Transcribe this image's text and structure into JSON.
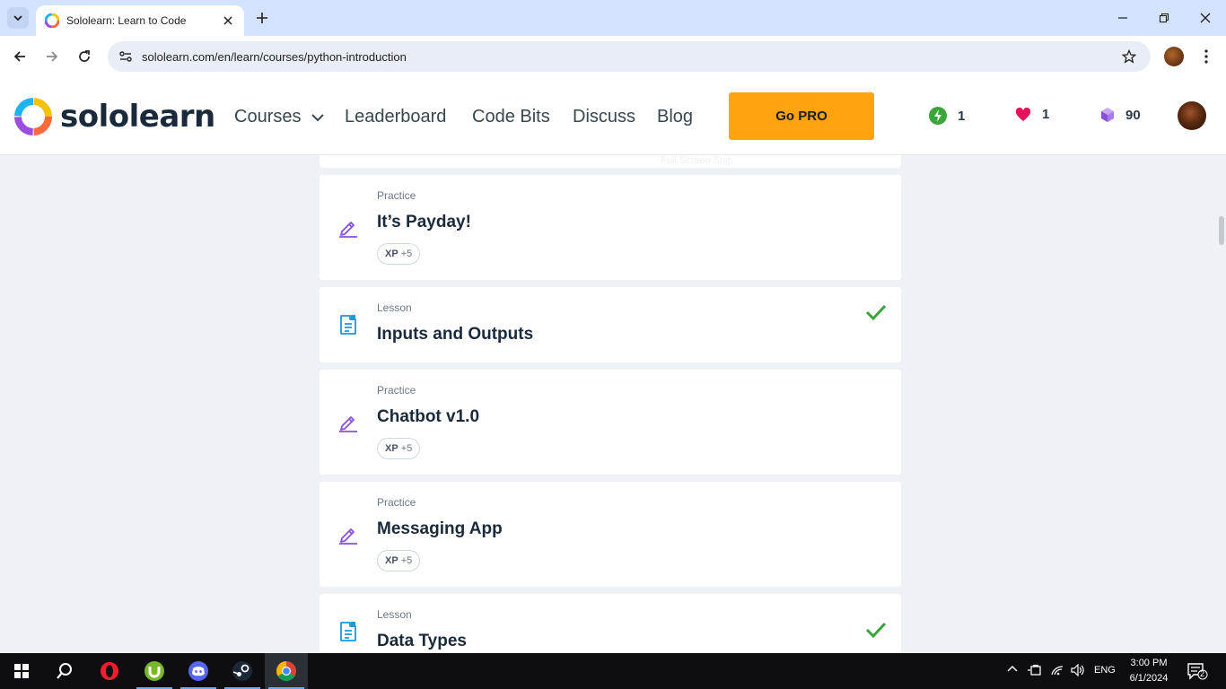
{
  "browser": {
    "tab_title": "Sololearn: Learn to Code",
    "url": "sololearn.com/en/learn/courses/python-introduction"
  },
  "header": {
    "logo_text": "sololearn",
    "nav": {
      "courses": "Courses",
      "leaderboard": "Leaderboard",
      "code_bits": "Code Bits",
      "discuss": "Discuss",
      "blog": "Blog"
    },
    "go_pro": "Go PRO",
    "streak": "1",
    "hearts": "1",
    "bits": "90"
  },
  "ghost_text": "Full Screen Snip",
  "cards": [
    {
      "kind": "Practice",
      "title": "It’s Payday!",
      "xp_label": "XP",
      "xp_value": "+5",
      "icon": "practice-pencil-icon"
    },
    {
      "kind": "Lesson",
      "title": "Inputs and Outputs",
      "completed": true,
      "icon": "lesson-document-icon"
    },
    {
      "kind": "Practice",
      "title": "Chatbot v1.0",
      "xp_label": "XP",
      "xp_value": "+5",
      "icon": "practice-pencil-icon"
    },
    {
      "kind": "Practice",
      "title": "Messaging App",
      "xp_label": "XP",
      "xp_value": "+5",
      "icon": "practice-pencil-icon"
    },
    {
      "kind": "Lesson",
      "title": "Data Types",
      "completed": true,
      "icon": "lesson-document-icon"
    }
  ],
  "taskbar": {
    "lang": "ENG",
    "time": "3:00 PM",
    "date": "6/1/2024",
    "notifications": "2"
  },
  "colors": {
    "accent_orange": "#ffa310",
    "check_green": "#3aa63a",
    "practice_purple": "#8a4fd8",
    "lesson_blue": "#1a9ad9"
  }
}
